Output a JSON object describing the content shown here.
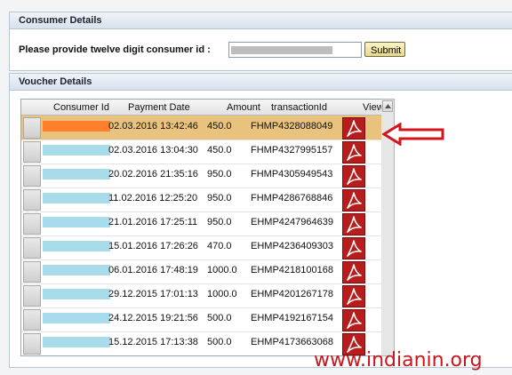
{
  "consumer_panel": {
    "title": "Consumer Details",
    "prompt": "Please provide twelve digit consumer id :",
    "submit_label": "Submit"
  },
  "voucher_panel": {
    "title": "Voucher Details",
    "columns": [
      "Consumer Id",
      "Payment Date",
      "Amount",
      "transactionId",
      "View"
    ],
    "rows": [
      {
        "date": "02.03.2016 13:42:46",
        "amount": "450.0",
        "txn": "FHMP4328088049",
        "selected": true
      },
      {
        "date": "02.03.2016 13:04:30",
        "amount": "450.0",
        "txn": "FHMP4327995157",
        "selected": false
      },
      {
        "date": "20.02.2016 21:35:16",
        "amount": "950.0",
        "txn": "FHMP4305949543",
        "selected": false
      },
      {
        "date": "11.02.2016 12:25:20",
        "amount": "950.0",
        "txn": "FHMP4286768846",
        "selected": false
      },
      {
        "date": "21.01.2016 17:25:11",
        "amount": "950.0",
        "txn": "EHMP4247964639",
        "selected": false
      },
      {
        "date": "15.01.2016 17:26:26",
        "amount": "470.0",
        "txn": "EHMP4236409303",
        "selected": false
      },
      {
        "date": "06.01.2016 17:48:19",
        "amount": "1000.0",
        "txn": "EHMP4218100168",
        "selected": false
      },
      {
        "date": "29.12.2015 17:01:13",
        "amount": "1000.0",
        "txn": "EHMP4201267178",
        "selected": false
      },
      {
        "date": "24.12.2015 19:21:56",
        "amount": "500.0",
        "txn": "EHMP4192167154",
        "selected": false
      },
      {
        "date": "15.12.2015 17:13:38",
        "amount": "500.0",
        "txn": "EHMP4173663068",
        "selected": false
      }
    ],
    "view_icon": "pdf-icon"
  },
  "watermark": "www.indianin.org",
  "colors": {
    "selected_row": "#e9c27d",
    "masked_id": "#a9dceb",
    "masked_id_selected": "#ff7f2a",
    "pdf_icon": "#b81d1d",
    "arrow": "#d4141b"
  }
}
